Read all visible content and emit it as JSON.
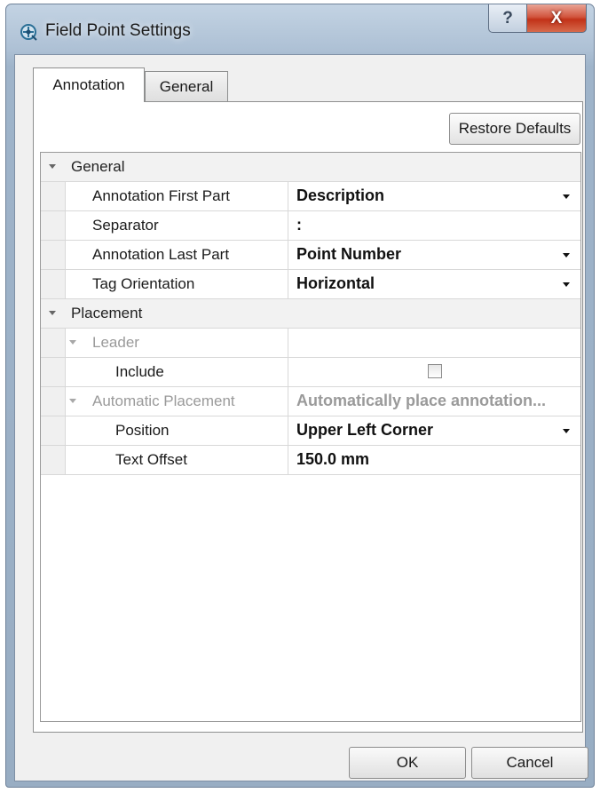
{
  "window": {
    "title": "Field Point Settings",
    "help_glyph": "?",
    "close_glyph": "X"
  },
  "tabs": [
    {
      "label": "Annotation",
      "selected": true
    },
    {
      "label": "General",
      "selected": false
    }
  ],
  "toolbar": {
    "restore_defaults_label": "Restore Defaults"
  },
  "property_grid": {
    "categories": [
      {
        "label": "General",
        "properties": [
          {
            "name": "Annotation First Part",
            "value": "Description",
            "dropdown": true
          },
          {
            "name": "Separator",
            "value": ":",
            "dropdown": false
          },
          {
            "name": "Annotation Last Part",
            "value": "Point Number",
            "dropdown": true
          },
          {
            "name": "Tag Orientation",
            "value": "Horizontal",
            "dropdown": true
          }
        ]
      },
      {
        "label": "Placement",
        "subgroups": [
          {
            "label": "Leader",
            "value": "",
            "properties": [
              {
                "name": "Include",
                "value_type": "checkbox",
                "checked": false
              }
            ]
          },
          {
            "label": "Automatic Placement",
            "value": "Automatically place annotation...",
            "properties": [
              {
                "name": "Position",
                "value": "Upper Left Corner",
                "dropdown": true
              },
              {
                "name": "Text Offset",
                "value": "150.0 mm",
                "dropdown": false
              }
            ]
          }
        ]
      }
    ]
  },
  "footer": {
    "ok_label": "OK",
    "cancel_label": "Cancel"
  },
  "icons": {
    "app": "field-point-settings-icon",
    "help": "help-icon",
    "close": "close-icon",
    "expand": "collapse-arrow-icon",
    "dropdown": "dropdown-arrow-icon"
  },
  "colors": {
    "titlebar": "#aec1d5",
    "close_button": "#c23218",
    "dialog_background": "#f0f0f0",
    "disabled_text": "#9a9a9a"
  }
}
